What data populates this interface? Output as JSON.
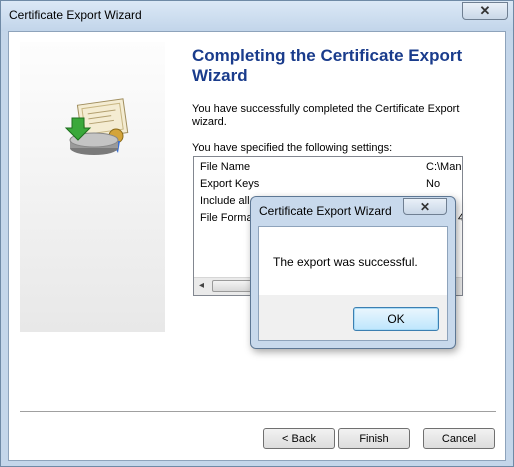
{
  "window": {
    "title": "Certificate Export Wizard",
    "close_glyph": "✕"
  },
  "main": {
    "heading": "Completing the Certificate Export Wizard",
    "paragraph": "You have successfully completed the Certificate Export wizard.",
    "settings_label": "You have specified the following settings:",
    "settings": [
      {
        "key": "File Name",
        "value": "C:\\Man"
      },
      {
        "key": "Export Keys",
        "value": "No"
      },
      {
        "key": "Include all",
        "value": ""
      },
      {
        "key": "File Forma",
        "value": "4"
      }
    ],
    "scroll_left_glyph": "◂"
  },
  "footer": {
    "back": "< Back",
    "finish": "Finish",
    "cancel": "Cancel"
  },
  "dialog": {
    "title": "Certificate Export Wizard",
    "close_glyph": "✕",
    "message": "The export was successful.",
    "ok": "OK"
  },
  "icons": {
    "wizard_art": "certificate-export-icon"
  }
}
